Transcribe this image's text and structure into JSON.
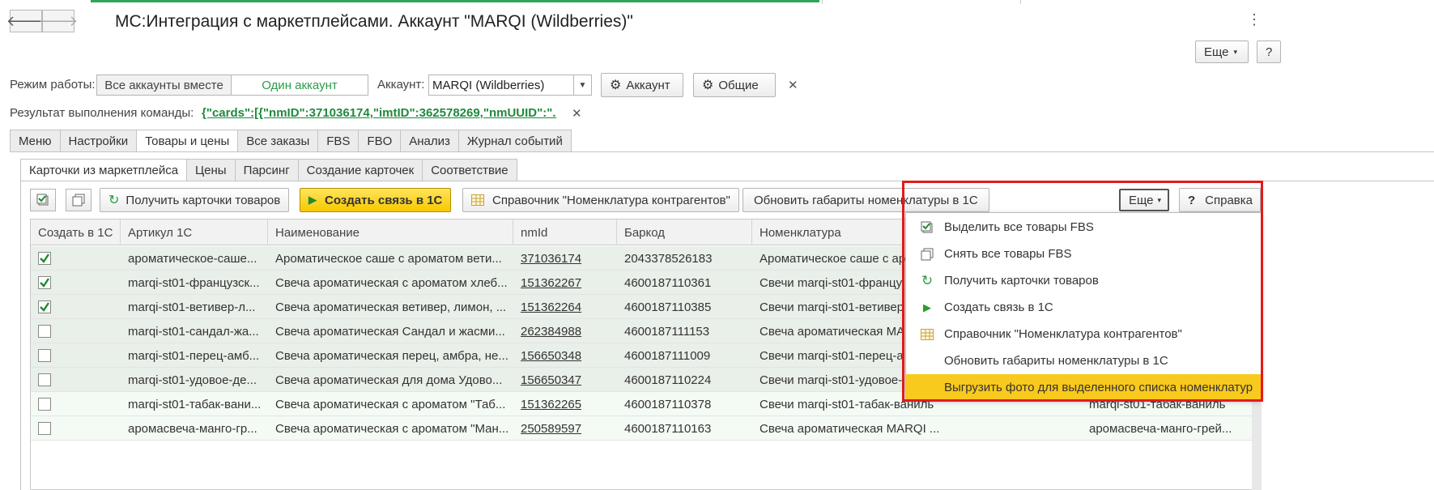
{
  "window": {
    "title": "МС:Интеграция с маркетплейсами. Аккаунт \"MARQI (Wildberries)\"",
    "more_label": "Еще",
    "kebab": "⋮"
  },
  "nav": {
    "back_icon": "arrow-left-icon",
    "forward_icon": "arrow-right-icon"
  },
  "mode": {
    "label": "Режим работы:",
    "options": [
      "Все аккаунты вместе",
      "Один аккаунт"
    ],
    "selected": "Один аккаунт"
  },
  "account": {
    "label": "Аккаунт:",
    "value": "MARQI (Wildberries)",
    "account_button": "Аккаунт",
    "general_button": "Общие"
  },
  "result": {
    "label": "Результат выполнения команды:",
    "value": "{\"cards\":[{\"nmID\":371036174,\"imtID\":362578269,\"nmUUID\":\"..."
  },
  "tabs_main": [
    "Меню",
    "Настройки",
    "Товары и цены",
    "Все заказы",
    "FBS",
    "FBO",
    "Анализ",
    "Журнал событий"
  ],
  "tabs_main_active": "Товары и цены",
  "tabs_sub": [
    "Карточки из маркетплейса",
    "Цены",
    "Парсинг",
    "Создание карточек",
    "Соответствие"
  ],
  "tabs_sub_active": "Карточки из маркетплейса",
  "toolbar": {
    "get_cards": "Получить карточки товаров",
    "create_link": "Создать связь в 1С",
    "reference": "Справочник \"Номенклатура контрагентов\"",
    "update_dims": "Обновить габариты номенклатуры в 1С",
    "more": "Еще",
    "help": "Справка"
  },
  "table": {
    "columns": [
      "Создать в 1С",
      "Артикул 1С",
      "Наименование",
      "nmId",
      "Баркод",
      "Номенклатура"
    ],
    "rows": [
      {
        "checked": true,
        "article": "ароматическое-саше...",
        "name": "Ароматическое саше с ароматом вети...",
        "nmid": "371036174",
        "barcode": "2043378526183",
        "nomen": "Ароматическое саше с ар",
        "extra": ""
      },
      {
        "checked": true,
        "article": "marqi-st01-французск...",
        "name": "Свеча ароматическая с ароматом хлеб...",
        "nmid": "151362267",
        "barcode": "4600187110361",
        "nomen": "Свечи marqi-st01-францу",
        "extra": ""
      },
      {
        "checked": true,
        "article": "marqi-st01-ветивер-л...",
        "name": "Свеча ароматическая ветивер, лимон, ...",
        "nmid": "151362264",
        "barcode": "4600187110385",
        "nomen": "Свечи marqi-st01-ветивер",
        "extra": ""
      },
      {
        "checked": false,
        "article": "marqi-st01-сандал-жа...",
        "name": "Свеча ароматическая Сандал и жасми...",
        "nmid": "262384988",
        "barcode": "4600187111153",
        "nomen": "Свеча ароматическая МА",
        "extra": ""
      },
      {
        "checked": false,
        "article": "marqi-st01-перец-амб...",
        "name": "Свеча ароматическая перец, амбра, не...",
        "nmid": "156650348",
        "barcode": "4600187111009",
        "nomen": "Свечи marqi-st01-перец-а",
        "extra": ""
      },
      {
        "checked": false,
        "article": "marqi-st01-удовое-де...",
        "name": "Свеча ароматическая для дома Удово...",
        "nmid": "156650347",
        "barcode": "4600187110224",
        "nomen": "Свечи marqi-st01-удовое-",
        "extra": ""
      },
      {
        "checked": false,
        "article": "marqi-st01-табак-вани...",
        "name": "Свеча ароматическая с ароматом \"Таб...",
        "nmid": "151362265",
        "barcode": "4600187110378",
        "nomen": "Свечи marqi-st01-табак-ваниль",
        "extra": "marqi-st01-табак-ваниль"
      },
      {
        "checked": false,
        "article": "аромасвеча-манго-гр...",
        "name": "Свеча ароматическая с ароматом \"Ман...",
        "nmid": "250589597",
        "barcode": "4600187110163",
        "nomen": "Свеча ароматическая MARQI ...",
        "extra": "аромасвеча-манго-грей..."
      }
    ]
  },
  "menu": {
    "items": [
      {
        "label": "Выделить все товары FBS",
        "icon": "check-all-icon"
      },
      {
        "label": "Снять все товары FBS",
        "icon": "uncheck-all-icon"
      },
      {
        "label": "Получить карточки товаров",
        "icon": "refresh-icon"
      },
      {
        "label": "Создать связь в 1С",
        "icon": "play-icon"
      },
      {
        "label": "Справочник \"Номенклатура контрагентов\"",
        "icon": "table-icon"
      },
      {
        "label": "Обновить габариты номенклатуры в 1С",
        "icon": ""
      },
      {
        "label": "Выгрузить фото для выделенного списка номенклатур",
        "icon": ""
      }
    ],
    "highlighted": "Выгрузить фото для выделенного списка номенклатур"
  },
  "colors": {
    "accent_green": "#2a9d4a",
    "highlight_yellow": "#f9c91d",
    "frame_red": "#e21b1b"
  }
}
